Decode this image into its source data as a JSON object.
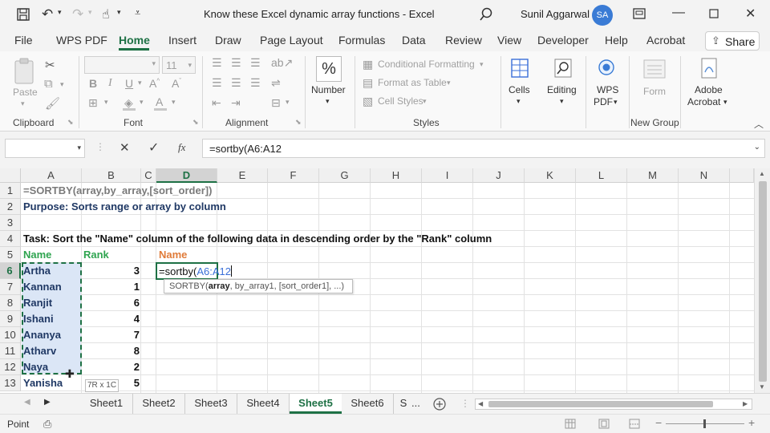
{
  "titlebar": {
    "title": "Know these Excel dynamic array functions  -  Excel",
    "user_name": "Sunil Aggarwal",
    "avatar_initials": "SA"
  },
  "menu": {
    "items": [
      "File",
      "WPS PDF",
      "Home",
      "Insert",
      "Draw",
      "Page Layout",
      "Formulas",
      "Data",
      "Review",
      "View",
      "Developer",
      "Help",
      "Acrobat"
    ],
    "active": "Home",
    "share_label": "Share"
  },
  "ribbon": {
    "clipboard": {
      "label": "Clipboard",
      "paste_label": "Paste"
    },
    "font": {
      "label": "Font",
      "font_size": "11"
    },
    "alignment": {
      "label": "Alignment"
    },
    "number": {
      "label": "Number",
      "button_label": "Number"
    },
    "styles": {
      "label": "Styles",
      "conditional_formatting": "Conditional Formatting",
      "format_as_table": "Format as Table",
      "cell_styles": "Cell Styles"
    },
    "cells": {
      "label": "Cells"
    },
    "editing": {
      "label": "Editing"
    },
    "wps_pdf": {
      "line1": "WPS",
      "line2": "PDF"
    },
    "new_group": {
      "label": "New Group",
      "form_label": "Form"
    },
    "adobe": {
      "line1": "Adobe",
      "line2": "Acrobat"
    }
  },
  "formula_bar": {
    "name_box": "",
    "fx_label": "fx",
    "formula": "=sortby(A6:A12"
  },
  "grid": {
    "columns": [
      "A",
      "B",
      "C",
      "D",
      "E",
      "F",
      "G",
      "H",
      "I",
      "J",
      "K",
      "L",
      "M",
      "N"
    ],
    "rows": [
      "1",
      "2",
      "3",
      "4",
      "5",
      "6",
      "7",
      "8",
      "9",
      "10",
      "11",
      "12",
      "13"
    ],
    "r1": "=SORTBY(array,by_array,[sort_order])",
    "r2": "Purpose: Sorts range or array by column",
    "r4": "Task: Sort the \"Name\" column of the following data in descending order by the \"Rank\" column",
    "header_name": "Name",
    "header_rank": "Rank",
    "header_result": "Name",
    "data": [
      {
        "name": "Artha",
        "rank": "3"
      },
      {
        "name": "Kannan",
        "rank": "1"
      },
      {
        "name": "Ranjit",
        "rank": "6"
      },
      {
        "name": "Ishani",
        "rank": "4"
      },
      {
        "name": "Ananya",
        "rank": "7"
      },
      {
        "name": "Atharv",
        "rank": "8"
      },
      {
        "name": "Naya",
        "rank": "2"
      },
      {
        "name": "Yanisha",
        "rank": "5"
      }
    ],
    "editing_prefix": "=sortby(",
    "editing_ref": "A6:A12",
    "tooltip_fn": "SORTBY(",
    "tooltip_bold": "array",
    "tooltip_rest": ", by_array1, [sort_order1], ...)",
    "selection_size": "7R x 1C"
  },
  "sheets": {
    "tabs": [
      "Sheet1",
      "Sheet2",
      "Sheet3",
      "Sheet4",
      "Sheet5",
      "Sheet6",
      "S"
    ],
    "active": "Sheet5",
    "more": "..."
  },
  "status": {
    "mode": "Point"
  },
  "colors": {
    "excel_green": "#1e7145",
    "bold_blue": "#1f3864",
    "green_text": "#2ea44f",
    "orange_text": "#e07b39",
    "ref_blue": "#3a6fd8",
    "selection_fill": "#dbe6f6"
  }
}
